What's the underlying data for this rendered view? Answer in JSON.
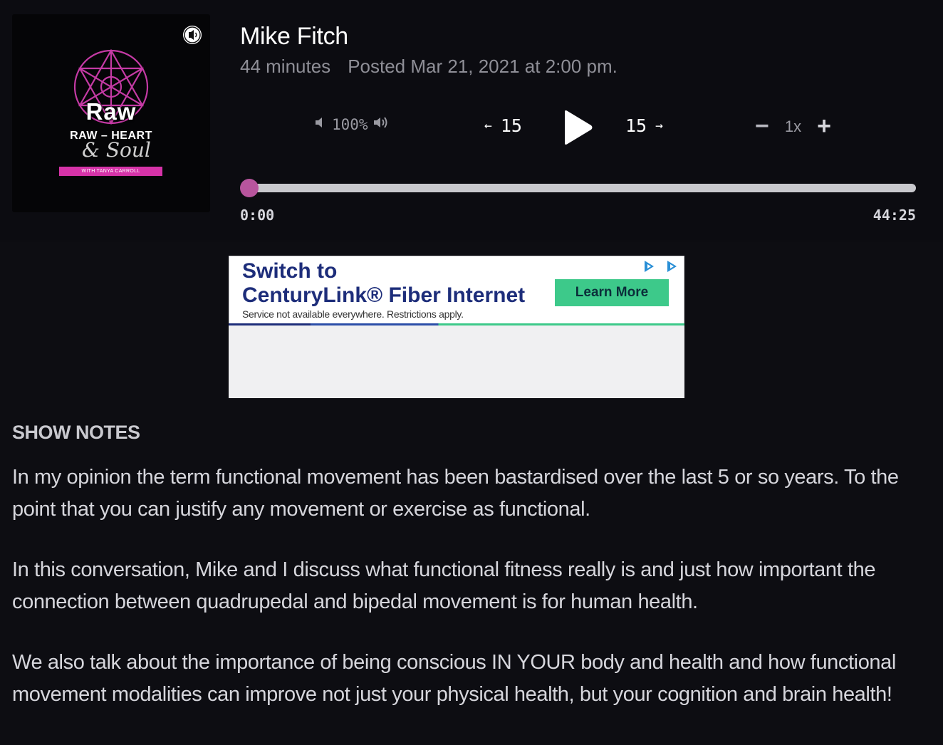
{
  "cover": {
    "title": "Raw",
    "subtitle": "RAW – HEART",
    "script": "& Soul",
    "strip": "WITH TANYA CARROLL"
  },
  "episode": {
    "title": "Mike Fitch",
    "duration": "44 minutes",
    "posted": "Posted Mar 21, 2021 at 2:00 pm."
  },
  "player": {
    "volume": "100%",
    "skip_back": "15",
    "skip_forward": "15",
    "skip_back_arrow": "←",
    "skip_forward_arrow": "→",
    "speed": "1x",
    "speed_minus": "−",
    "speed_plus": "+",
    "current_time": "0:00",
    "total_time": "44:25",
    "progress_fraction": 0.012,
    "accent_color": "#b8559d"
  },
  "ad": {
    "headline_line1": "Switch to",
    "headline_line2": "CenturyLink® Fiber Internet",
    "fine_print": "Service not available everywhere. Restrictions apply.",
    "cta": "Learn More"
  },
  "show_notes": {
    "heading": "SHOW NOTES",
    "paragraphs": [
      "In my opinion the term functional movement has been bastardised over the last 5 or so years. To the point that you can justify any movement or exercise as functional.",
      "In this conversation, Mike and I discuss what functional fitness really is and just how important the connection between quadrupedal and bipedal movement is for human health.",
      "We also talk about the importance of being conscious IN YOUR body and health and how functional movement modalities can improve not just your physical health, but your cognition and brain health!"
    ]
  }
}
